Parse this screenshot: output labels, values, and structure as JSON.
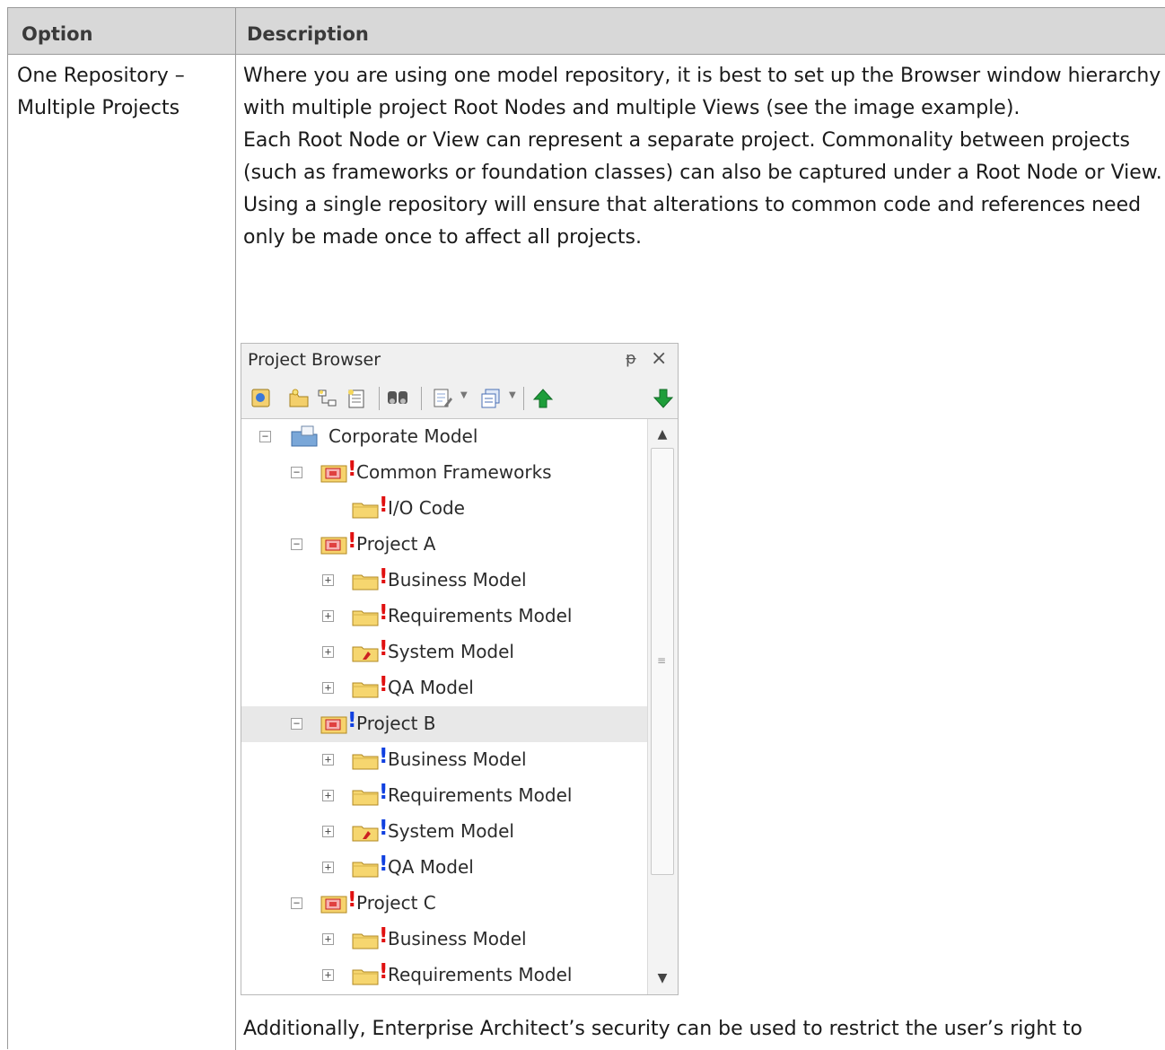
{
  "table": {
    "headers": {
      "option": "Option",
      "description": "Description"
    },
    "row": {
      "option": "One Repository – Multiple Projects",
      "paragraphs": [
        "Where you are using one model repository, it is best to set up the Browser window hierarchy with multiple project Root Nodes and multiple Views (see the image example).",
        "Each Root Node or View can represent a separate project. Commonality between projects (such as frameworks or foundation classes) can also be captured under a Root Node or View.",
        "Using a single repository will ensure that alterations to common code and references need only be made once to affect all projects."
      ],
      "footer": "Additionally, Enterprise Architect’s security can be used to restrict the user’s right to"
    }
  },
  "browser": {
    "title": "Project Browser",
    "pin_icon": "pin-icon",
    "close_icon": "close-icon",
    "toolbar_icons": [
      "new-model-icon",
      "new-package-icon",
      "new-diagram-icon",
      "new-element-icon",
      "find-icon",
      "properties-icon",
      "view-options-icon",
      "move-up-icon",
      "move-down-icon"
    ],
    "tree": [
      {
        "label": "Corporate Model",
        "icon": "model-root-icon",
        "expander": "−",
        "marker": ""
      },
      {
        "label": "Common Frameworks",
        "icon": "view-icon",
        "expander": "−",
        "marker": "red"
      },
      {
        "label": "I/O Code",
        "icon": "package-icon",
        "expander": "",
        "marker": "red"
      },
      {
        "label": "Project A",
        "icon": "view-icon",
        "expander": "−",
        "marker": "red"
      },
      {
        "label": "Business Model",
        "icon": "package-icon",
        "expander": "+",
        "marker": "red"
      },
      {
        "label": "Requirements Model",
        "icon": "package-icon",
        "expander": "+",
        "marker": "red"
      },
      {
        "label": "System Model",
        "icon": "system-package-icon",
        "expander": "+",
        "marker": "red"
      },
      {
        "label": "QA Model",
        "icon": "package-icon",
        "expander": "+",
        "marker": "red"
      },
      {
        "label": "Project B",
        "icon": "view-icon",
        "expander": "−",
        "marker": "blue",
        "selected": true
      },
      {
        "label": "Business Model",
        "icon": "package-icon",
        "expander": "+",
        "marker": "blue"
      },
      {
        "label": "Requirements Model",
        "icon": "package-icon",
        "expander": "+",
        "marker": "blue"
      },
      {
        "label": "System Model",
        "icon": "system-package-icon",
        "expander": "+",
        "marker": "blue"
      },
      {
        "label": "QA Model",
        "icon": "package-icon",
        "expander": "+",
        "marker": "blue"
      },
      {
        "label": "Project C",
        "icon": "view-icon",
        "expander": "−",
        "marker": "red"
      },
      {
        "label": "Business Model",
        "icon": "package-icon",
        "expander": "+",
        "marker": "red"
      },
      {
        "label": "Requirements Model",
        "icon": "package-icon",
        "expander": "+",
        "marker": "red"
      }
    ]
  }
}
